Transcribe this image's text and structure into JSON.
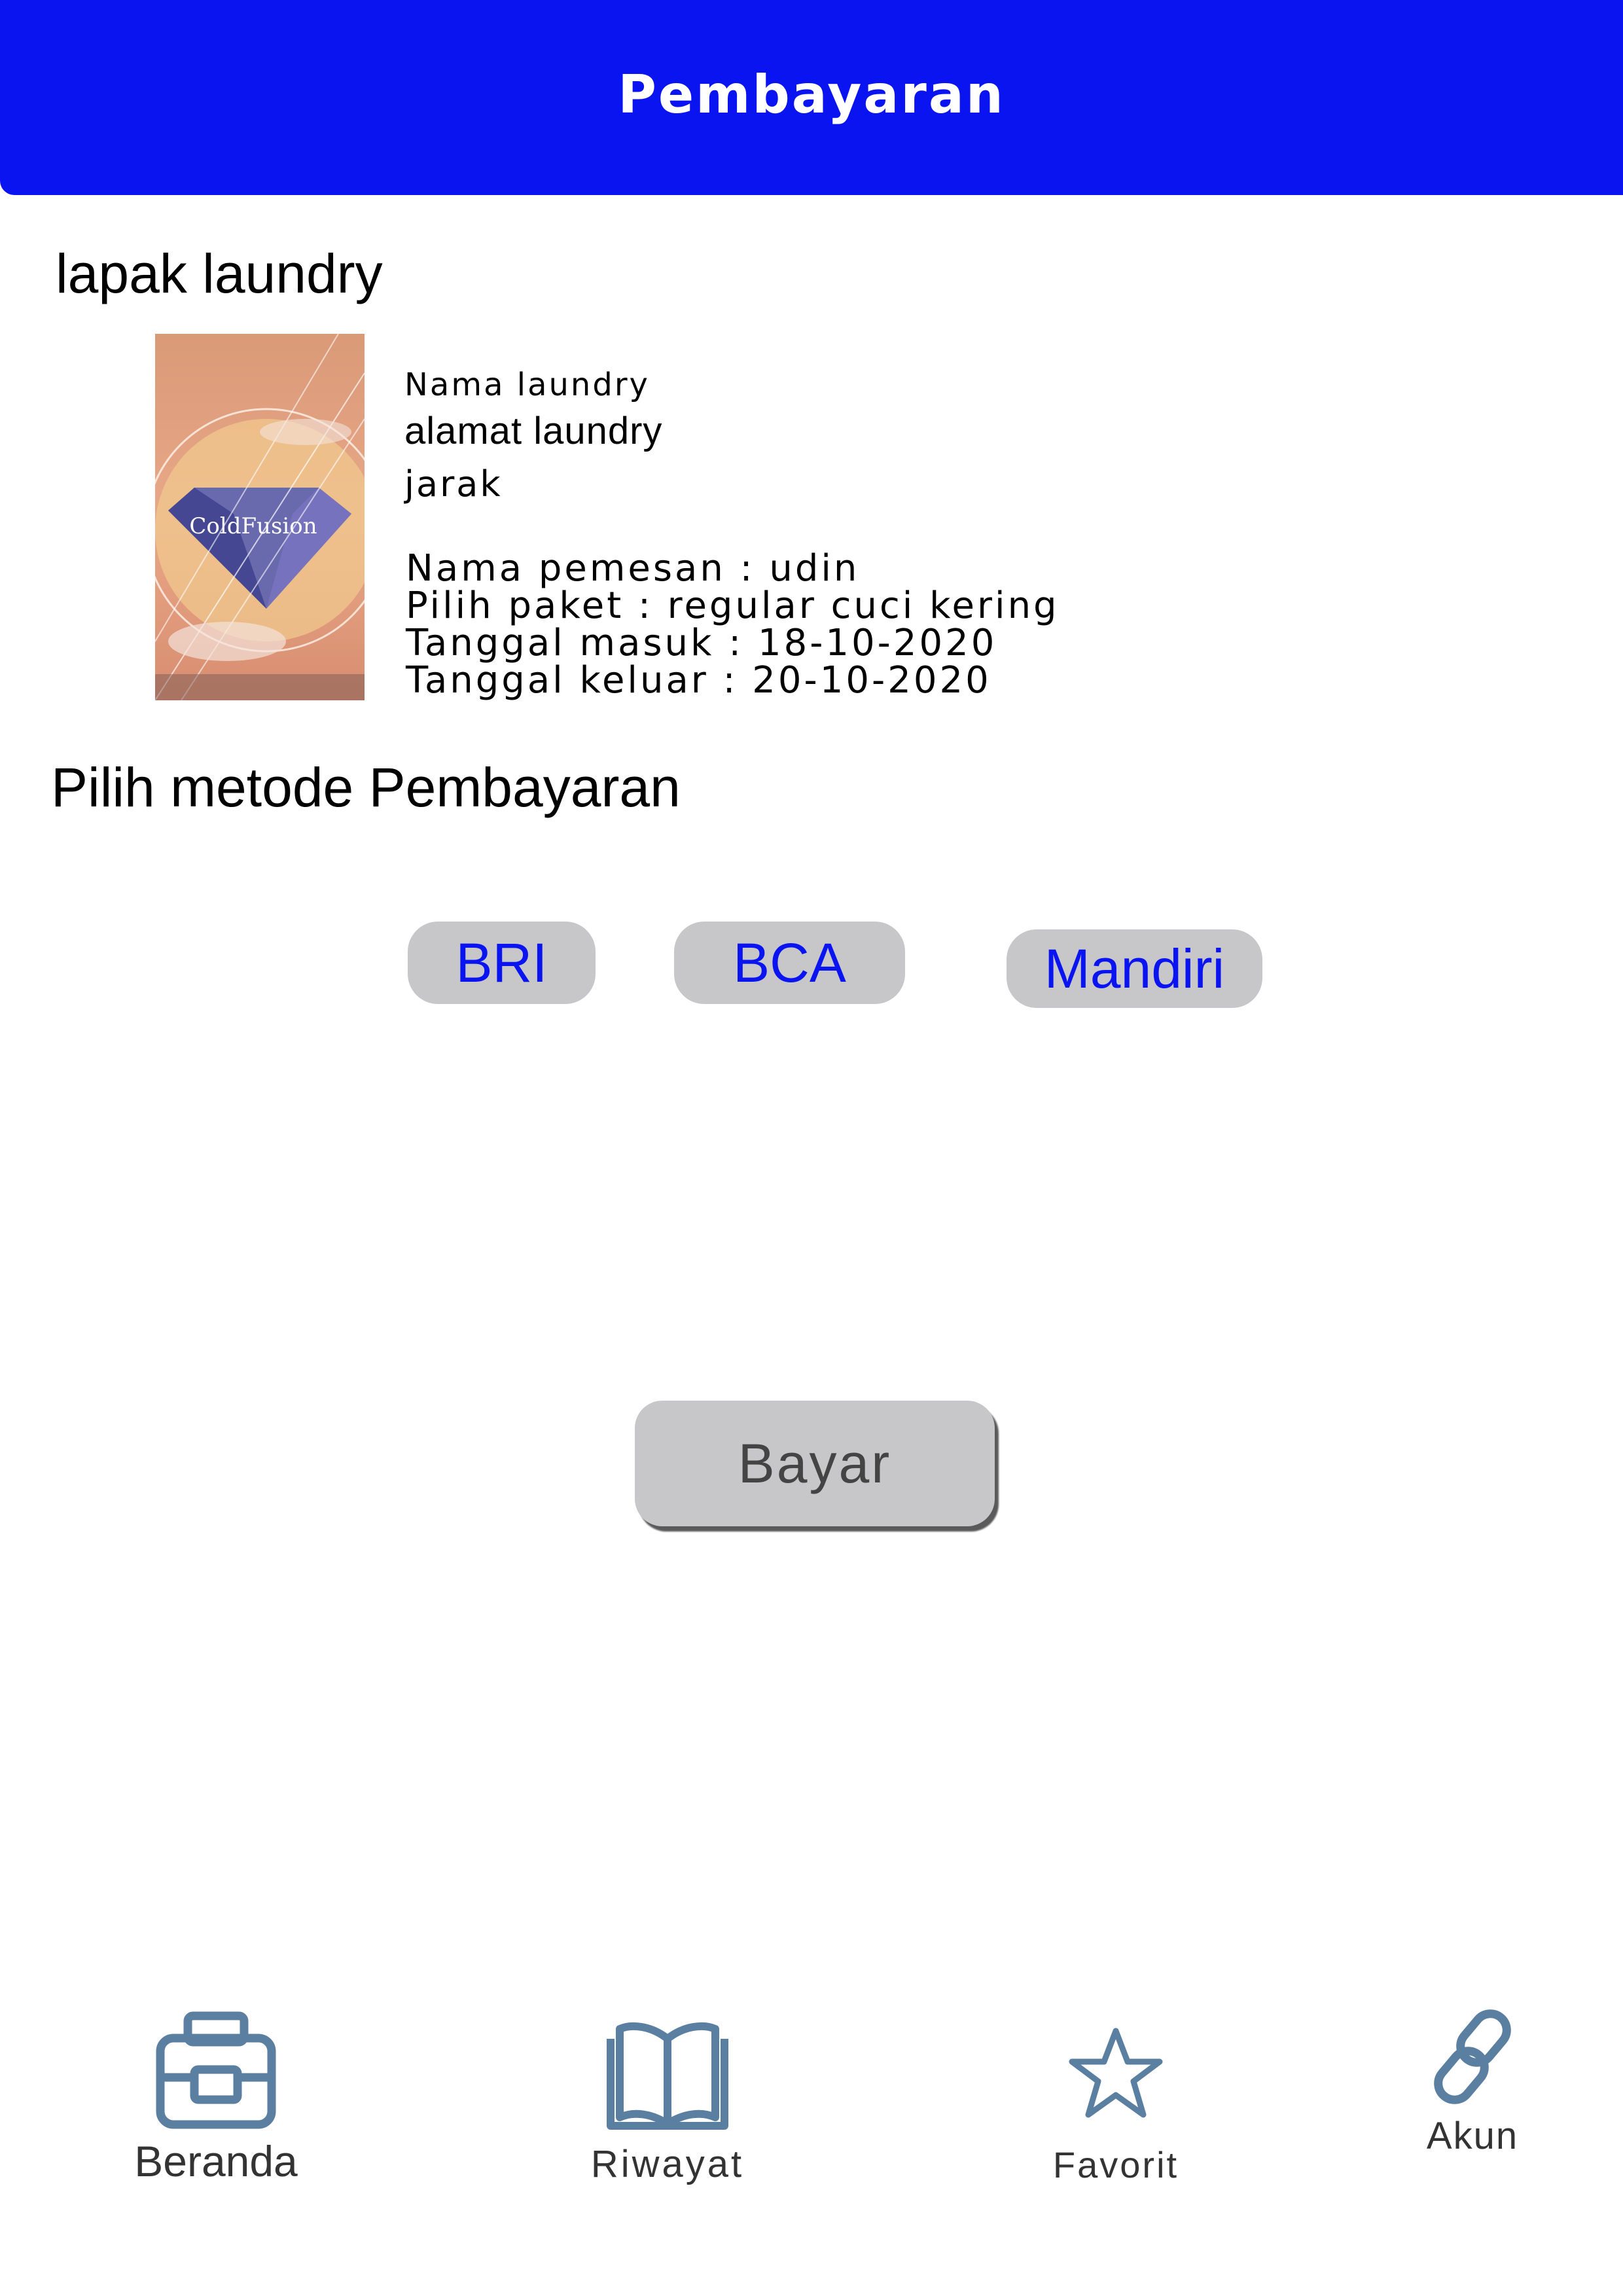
{
  "header": {
    "title": "Pembayaran"
  },
  "shop": {
    "heading": "lapak laundry",
    "image_label": "ColdFusion",
    "name": "Nama laundry",
    "address": "alamat laundry",
    "distance": "jarak",
    "details": [
      "Nama pemesan : udin",
      "Pilih paket : regular cuci kering",
      "Tanggal masuk : 18-10-2020",
      "Tanggal keluar : 20-10-2020"
    ]
  },
  "payment": {
    "heading": "Pilih metode Pembayaran",
    "methods": [
      "BRI",
      "BCA",
      "Mandiri"
    ],
    "pay_label": "Bayar"
  },
  "nav": {
    "items": [
      {
        "label": "Beranda",
        "icon": "toolbox-icon"
      },
      {
        "label": "Riwayat",
        "icon": "book-icon"
      },
      {
        "label": "Favorit",
        "icon": "star-icon"
      },
      {
        "label": "Akun",
        "icon": "link-icon"
      }
    ]
  },
  "colors": {
    "header_bg": "#0a14f0",
    "bank_text": "#0a14f0",
    "button_bg": "#c7c7c9",
    "icon": "#5a7fa0"
  }
}
